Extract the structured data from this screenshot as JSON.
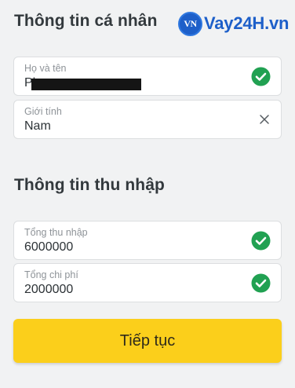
{
  "personal_section": {
    "title": "Thông tin cá nhân"
  },
  "watermark": {
    "logo_text": "VN",
    "brand": "Vay24H.vn"
  },
  "fields": {
    "fullname": {
      "label": "Họ và tên",
      "value": "Ph",
      "status_icon": "check-circle-icon",
      "redacted": true
    },
    "gender": {
      "label": "Giới tính",
      "value": "Nam",
      "action_icon": "clear-x-icon"
    },
    "income": {
      "label": "Tổng thu nhập",
      "value": "6000000",
      "status_icon": "check-circle-icon"
    },
    "expense": {
      "label": "Tổng chi phí",
      "value": "2000000",
      "status_icon": "check-circle-icon"
    }
  },
  "income_section": {
    "title": "Thông tin thu nhập"
  },
  "continue_button": {
    "label": "Tiếp tục"
  },
  "colors": {
    "background": "#f1f2f3",
    "accent_button": "#fbcf1b",
    "check_green": "#21a152",
    "brand_blue": "#1d5fc9"
  }
}
